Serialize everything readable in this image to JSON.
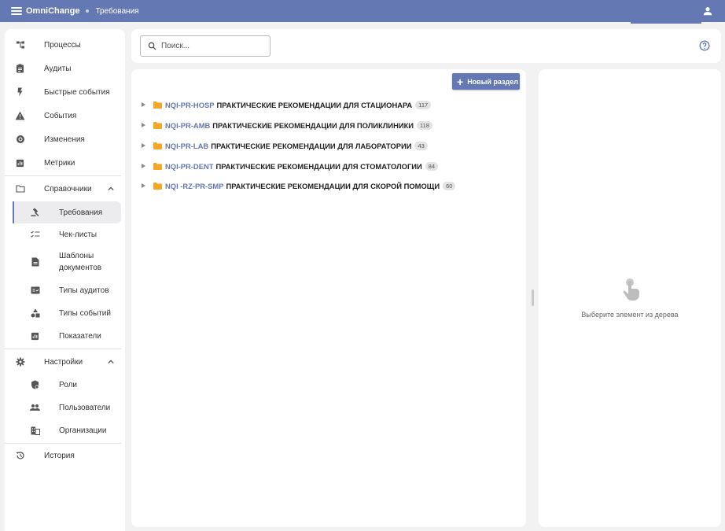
{
  "app": {
    "title": "OmniChange",
    "breadcrumb": "Требования"
  },
  "colors": {
    "accent": "#6478b4",
    "folder": "#f5a623",
    "background": "#f2f2f2"
  },
  "sidebar": {
    "items": [
      {
        "label": "Процессы",
        "icon": "process-tree-icon"
      },
      {
        "label": "Аудиты",
        "icon": "clipboard-icon"
      },
      {
        "label": "Быстрые события",
        "icon": "lightning-icon"
      },
      {
        "label": "События",
        "icon": "warning-icon"
      },
      {
        "label": "Изменения",
        "icon": "change-circle-icon"
      },
      {
        "label": "Метрики",
        "icon": "chart-icon"
      }
    ],
    "reference": {
      "label": "Справочники",
      "icon": "folder-outline-icon",
      "expanded": true,
      "items": [
        {
          "label": "Требования",
          "icon": "gavel-icon",
          "active": true
        },
        {
          "label": "Чек-листы",
          "icon": "checklist-icon"
        },
        {
          "label": "Шаблоны документов",
          "icon": "document-icon"
        },
        {
          "label": "Типы аудитов",
          "icon": "fact-check-icon"
        },
        {
          "label": "Типы событий",
          "icon": "category-icon"
        },
        {
          "label": "Показатели",
          "icon": "chart-icon"
        }
      ]
    },
    "settings": {
      "label": "Настройки",
      "icon": "gear-icon",
      "expanded": true,
      "items": [
        {
          "label": "Роли",
          "icon": "shield-icon"
        },
        {
          "label": "Пользователи",
          "icon": "people-icon"
        },
        {
          "label": "Организации",
          "icon": "building-icon"
        }
      ]
    },
    "history": {
      "label": "История",
      "icon": "history-icon"
    }
  },
  "search": {
    "placeholder": "Поиск...",
    "value": ""
  },
  "toolbar": {
    "new_section_label": "Новый раздел"
  },
  "tree": [
    {
      "code": "NQI-PR-HOSP",
      "title": "ПРАКТИЧЕСКИЕ РЕКОМЕНДАЦИИ ДЛЯ СТАЦИОНАРА",
      "count": "117"
    },
    {
      "code": "NQI-PR-AMB",
      "title": "ПРАКТИЧЕСКИЕ РЕКОМЕНДАЦИИ ДЛЯ ПОЛИКЛИНИКИ",
      "count": "118"
    },
    {
      "code": "NQI-PR-LAB",
      "title": "ПРАКТИЧЕСКИЕ РЕКОМЕНДАЦИИ ДЛЯ ЛАБОРАТОРИИ",
      "count": "43"
    },
    {
      "code": "NQI-PR-DENT",
      "title": "ПРАКТИЧЕСКИЕ РЕКОМЕНДАЦИИ ДЛЯ СТОМАТОЛОГИИ",
      "count": "84"
    },
    {
      "code": "NQI -RZ-PR-SMP",
      "title": "ПРАКТИЧЕСКИЕ РЕКОМЕНДАЦИИ ДЛЯ СКОРОЙ ПОМОЩИ",
      "count": "60"
    }
  ],
  "detail": {
    "empty_text": "Выберите элемент из дерева",
    "icon": "touch-icon"
  }
}
